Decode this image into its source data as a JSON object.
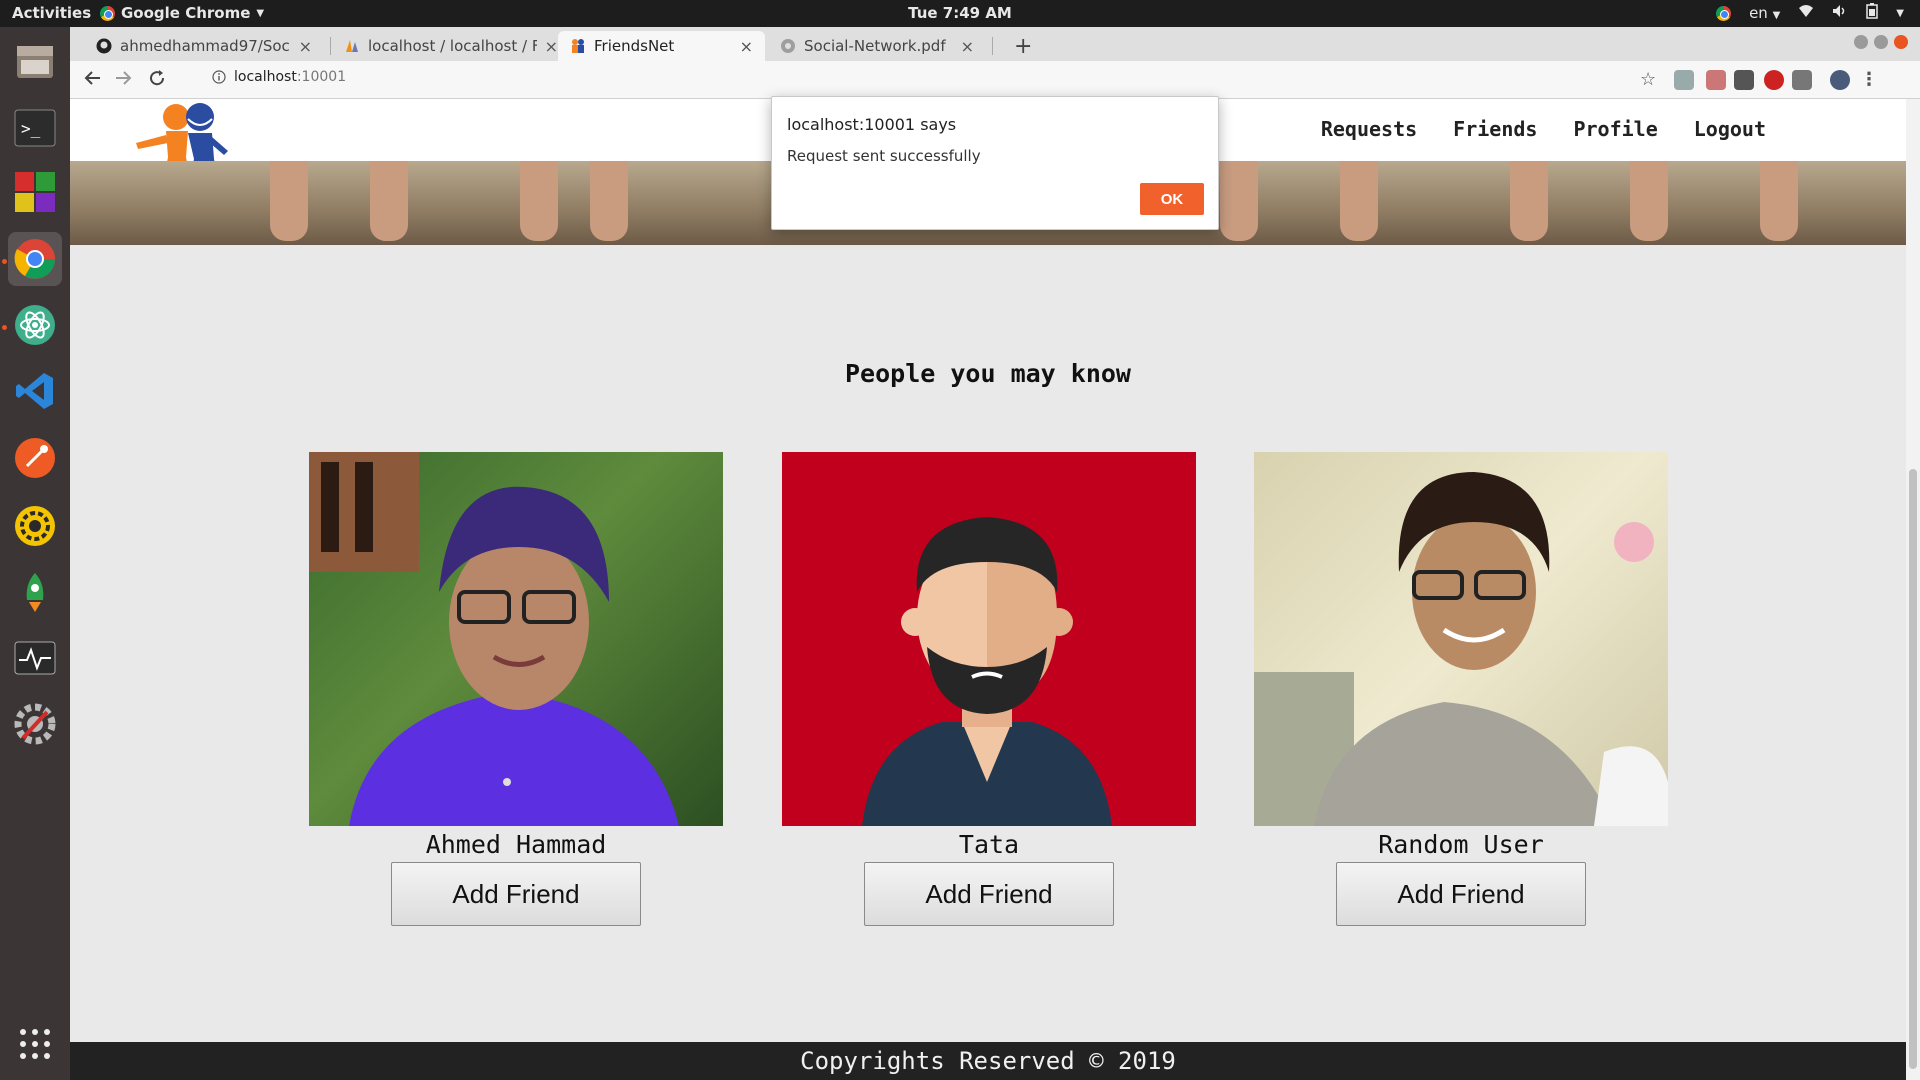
{
  "system_bar": {
    "activities": "Activities",
    "app_name": "Google Chrome",
    "clock": "Tue  7:49 AM",
    "language": "en"
  },
  "browser": {
    "tabs": [
      {
        "title": "ahmedhammad97/Social",
        "icon": "github-icon"
      },
      {
        "title": "localhost / localhost / Frie",
        "icon": "phpmyadmin-icon"
      },
      {
        "title": "FriendsNet",
        "icon": "friendsnet-icon",
        "active": true
      },
      {
        "title": "Social-Network.pdf",
        "icon": "pdf-icon"
      }
    ],
    "url_host": "localhost",
    "url_port": ":10001"
  },
  "site": {
    "nav": [
      "Requests",
      "Friends",
      "Profile",
      "Logout"
    ],
    "section_title": "People you may know",
    "people": [
      {
        "name": "Ahmed Hammad",
        "button": "Add Friend"
      },
      {
        "name": "Tata",
        "button": "Add Friend"
      },
      {
        "name": "Random User",
        "button": "Add Friend"
      }
    ],
    "footer": "Copyrights Reserved © 2019"
  },
  "alert": {
    "title": "localhost:10001 says",
    "message": "Request sent successfully",
    "ok_label": "OK"
  },
  "colors": {
    "accent": "#f0612c",
    "avatar_bg": "#c0001c",
    "footer_bg": "#222222"
  }
}
